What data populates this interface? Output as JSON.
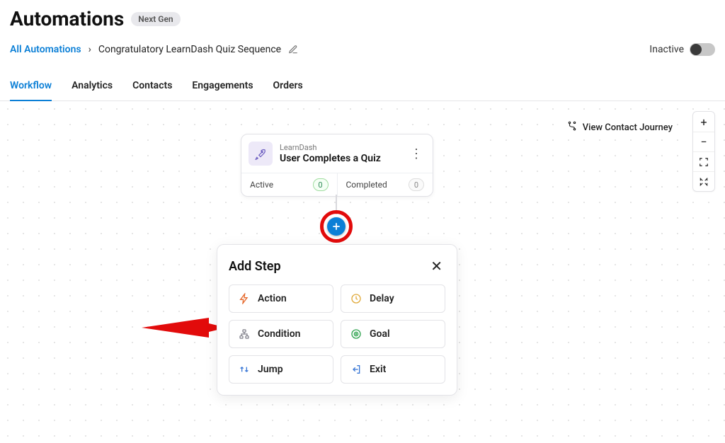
{
  "header": {
    "title": "Automations",
    "badge": "Next Gen"
  },
  "breadcrumb": {
    "root": "All Automations",
    "current": "Congratulatory LearnDash Quiz Sequence"
  },
  "status": {
    "label": "Inactive"
  },
  "tabs": [
    {
      "label": "Workflow",
      "active": true
    },
    {
      "label": "Analytics",
      "active": false
    },
    {
      "label": "Contacts",
      "active": false
    },
    {
      "label": "Engagements",
      "active": false
    },
    {
      "label": "Orders",
      "active": false
    }
  ],
  "canvas": {
    "view_journey": "View Contact Journey"
  },
  "trigger": {
    "source": "LearnDash",
    "title": "User Completes a Quiz",
    "active_label": "Active",
    "active_count": "0",
    "completed_label": "Completed",
    "completed_count": "0"
  },
  "modal": {
    "title": "Add Step",
    "options": {
      "action": "Action",
      "delay": "Delay",
      "condition": "Condition",
      "goal": "Goal",
      "jump": "Jump",
      "exit": "Exit"
    }
  }
}
